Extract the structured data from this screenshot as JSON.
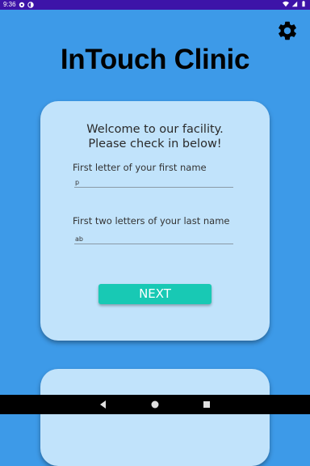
{
  "status_bar": {
    "time": "9:36",
    "left_icons": [
      "settings-status-icon",
      "sync-status-icon"
    ],
    "right_icons": [
      "wifi-icon",
      "signal-icon",
      "battery-icon"
    ]
  },
  "header": {
    "title": "InTouch Clinic",
    "settings_icon": "gear-icon"
  },
  "checkin_card": {
    "welcome_line1": "Welcome to our facility.",
    "welcome_line2": "Please check in below!",
    "first_name_label": "First letter of your first name",
    "first_name_value": "p",
    "last_name_label": "First two letters of your last name",
    "last_name_value": "ab",
    "next_label": "NEXT"
  },
  "nav_bar": {
    "icons": [
      "back-icon",
      "home-icon",
      "recents-icon"
    ]
  },
  "colors": {
    "background": "#3d9ae8",
    "status_bar": "#3d14a8",
    "card": "#c1e3fb",
    "button": "#18c9b4"
  }
}
